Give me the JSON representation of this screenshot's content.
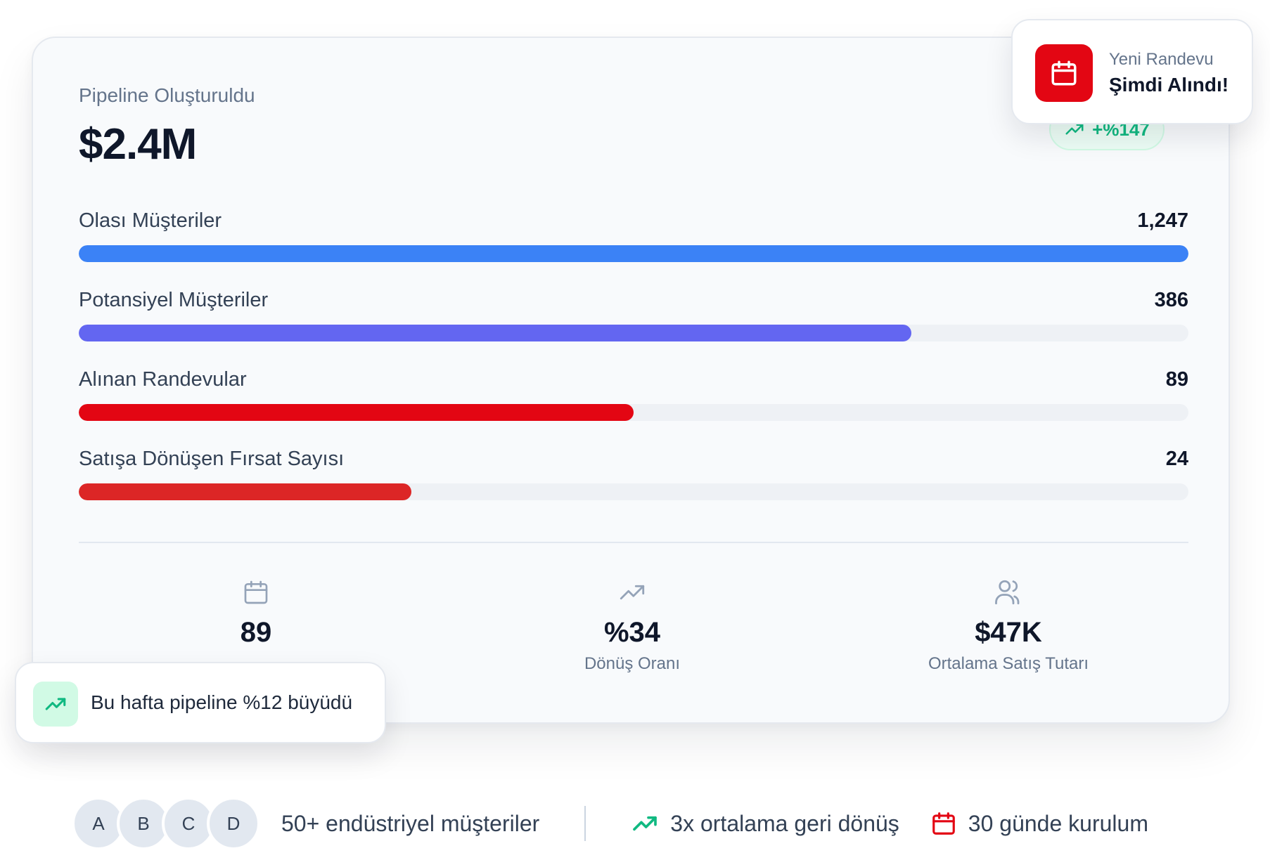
{
  "pipeline": {
    "label": "Pipeline Oluşturuldu",
    "value": "$2.4M",
    "growth_badge": "+%147"
  },
  "funnel": [
    {
      "label": "Olası Müşteriler",
      "value": "1,247",
      "fill": 1.0,
      "color": "#3b82f6"
    },
    {
      "label": "Potansiyel Müşteriler",
      "value": "386",
      "fill": 0.75,
      "color": "#6366f1"
    },
    {
      "label": "Alınan Randevular",
      "value": "89",
      "fill": 0.5,
      "color": "#e30613"
    },
    {
      "label": "Satışa Dönüşen Fırsat Sayısı",
      "value": "24",
      "fill": 0.3,
      "color": "#dc2626"
    }
  ],
  "stats": [
    {
      "icon": "calendar-icon",
      "value": "89",
      "label": ""
    },
    {
      "icon": "trending-up-icon",
      "value": "%34",
      "label": "Dönüş Oranı"
    },
    {
      "icon": "users-icon",
      "value": "$47K",
      "label": "Ortalama Satış Tutarı"
    }
  ],
  "notification": {
    "line1": "Yeni Randevu",
    "line2": "Şimdi Alındı!",
    "icon": "calendar-icon"
  },
  "toast": {
    "text": "Bu hafta pipeline %12 büyüdü",
    "icon": "trending-up-icon"
  },
  "trust_bar": {
    "avatars": [
      "A",
      "B",
      "C",
      "D"
    ],
    "clients": "50+ endüstriyel müşteriler",
    "roi": "3x ortalama geri dönüş",
    "setup": "30 günde kurulum"
  },
  "colors": {
    "accent_red": "#e30613",
    "green": "#10b981",
    "blue": "#3b82f6",
    "indigo": "#6366f1"
  }
}
